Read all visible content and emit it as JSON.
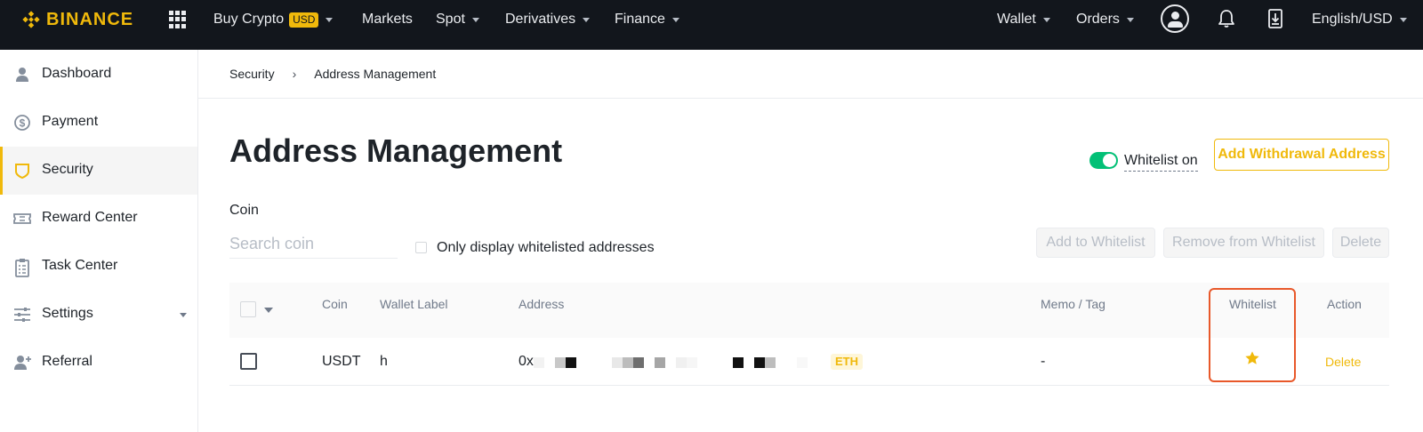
{
  "topbar": {
    "brand": "BINANCE",
    "nav": [
      {
        "label": "Buy Crypto",
        "badge": "USD"
      },
      {
        "label": "Markets"
      },
      {
        "label": "Spot"
      },
      {
        "label": "Derivatives"
      },
      {
        "label": "Finance"
      }
    ],
    "right": {
      "wallet": "Wallet",
      "orders": "Orders",
      "language": "English/USD"
    },
    "icons": [
      "apps-grid-icon",
      "profile-icon",
      "bell-icon",
      "download-icon"
    ]
  },
  "sidebar": {
    "items": [
      {
        "label": "Dashboard",
        "icon": "user-icon"
      },
      {
        "label": "Payment",
        "icon": "dollar-icon"
      },
      {
        "label": "Security",
        "icon": "shield-icon",
        "active": true
      },
      {
        "label": "Reward Center",
        "icon": "ticket-icon"
      },
      {
        "label": "Task Center",
        "icon": "clipboard-icon"
      },
      {
        "label": "Settings",
        "icon": "sliders-icon",
        "expandable": true
      },
      {
        "label": "Referral",
        "icon": "add-user-icon"
      }
    ]
  },
  "breadcrumb": {
    "parent": "Security",
    "current": "Address Management"
  },
  "page": {
    "title": "Address Management",
    "whitelist_toggle_label": "Whitelist on",
    "whitelist_on": true,
    "add_button": "Add Withdrawal Address"
  },
  "filters": {
    "coin_label": "Coin",
    "search_placeholder": "Search coin",
    "only_whitelisted_label": "Only display whitelisted addresses",
    "only_whitelisted_checked": false
  },
  "actions": {
    "add_to_whitelist": "Add to Whitelist",
    "remove_from_whitelist": "Remove from Whitelist",
    "delete": "Delete"
  },
  "table": {
    "columns": [
      "Coin",
      "Wallet Label",
      "Address",
      "Memo / Tag",
      "Whitelist",
      "Action"
    ],
    "rows": [
      {
        "coin": "USDT",
        "wallet_label": "h",
        "address_prefix": "0x",
        "network": "ETH",
        "memo": "-",
        "whitelisted": true,
        "action": "Delete"
      }
    ]
  },
  "colors": {
    "brand": "#f0b90b",
    "topbar_bg": "#12161c",
    "toggle_on": "#02c076",
    "highlight": "#e8582a"
  }
}
